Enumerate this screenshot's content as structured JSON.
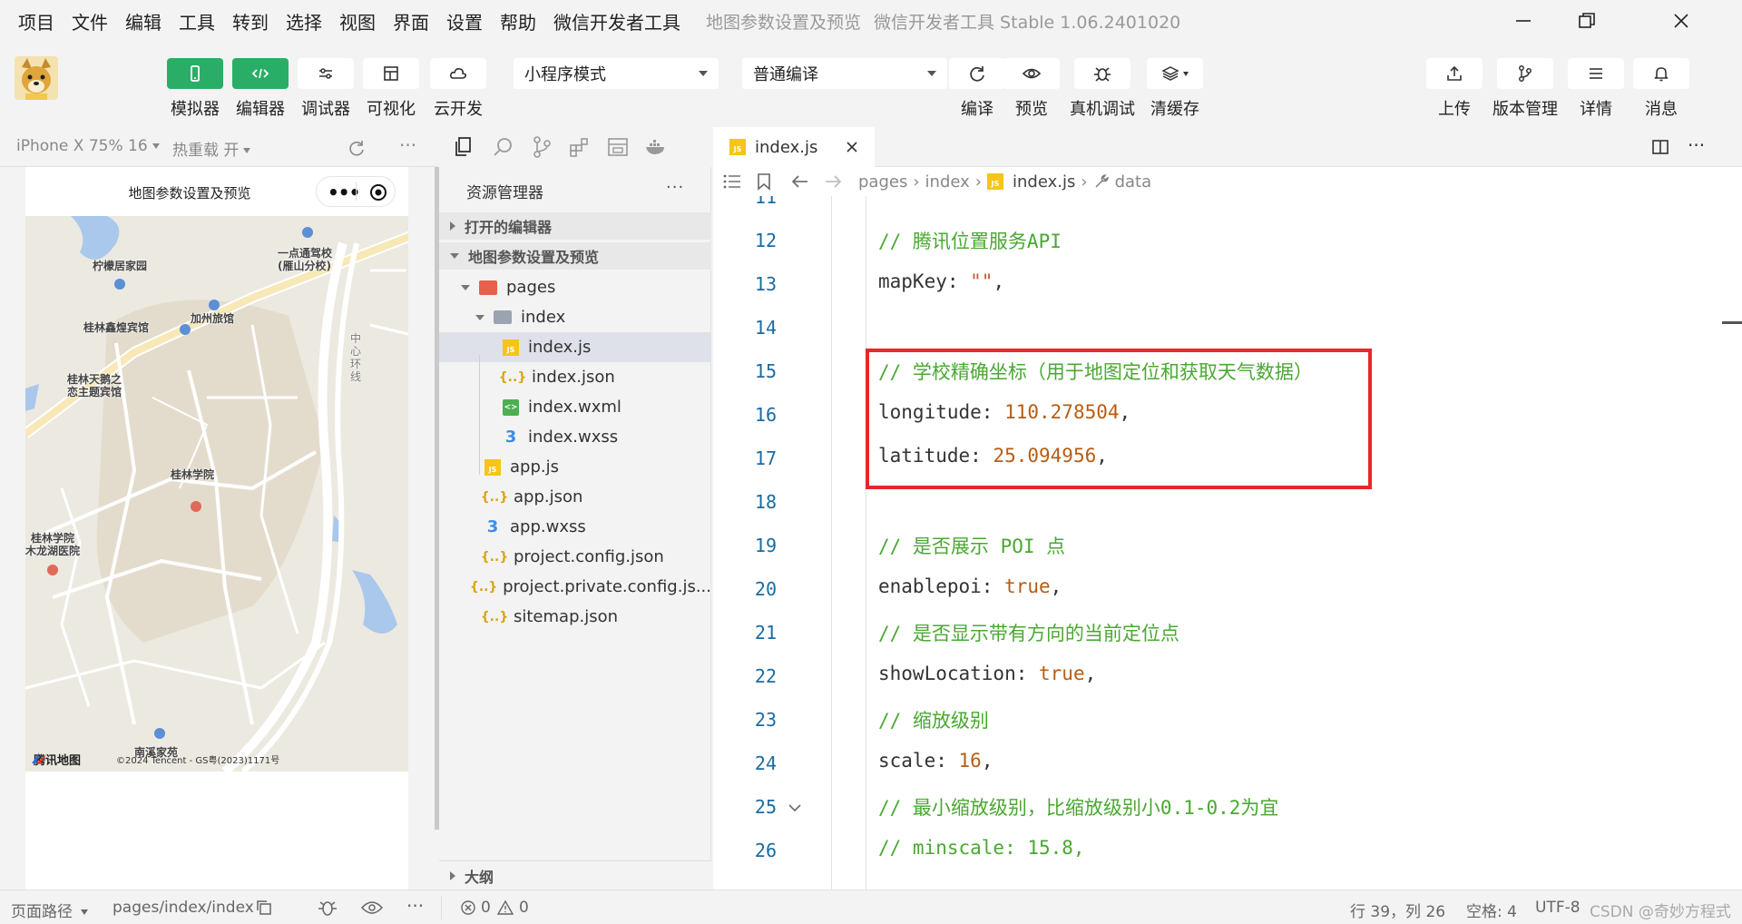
{
  "menu": [
    "项目",
    "文件",
    "编辑",
    "工具",
    "转到",
    "选择",
    "视图",
    "界面",
    "设置",
    "帮助",
    "微信开发者工具"
  ],
  "window": {
    "title": "地图参数设置及预览",
    "subtitle": "微信开发者工具 Stable 1.06.2401020"
  },
  "toolbar": {
    "left_buttons": [
      {
        "label": "模拟器",
        "icon": "phone-icon",
        "active": true
      },
      {
        "label": "编辑器",
        "icon": "code-icon",
        "active": true
      },
      {
        "label": "调试器",
        "icon": "sliders-icon",
        "active": false
      },
      {
        "label": "可视化",
        "icon": "layout-icon",
        "active": false
      },
      {
        "label": "云开发",
        "icon": "cloud-icon",
        "active": false
      }
    ],
    "mode_select": "小程序模式",
    "compile_select": "普通编译",
    "mid_buttons": [
      {
        "label": "编译",
        "icon": "refresh-icon"
      },
      {
        "label": "预览",
        "icon": "eye-icon"
      },
      {
        "label": "真机调试",
        "icon": "bug-icon"
      },
      {
        "label": "清缓存",
        "icon": "layers-icon"
      }
    ],
    "right_buttons": [
      {
        "label": "上传",
        "icon": "upload-icon"
      },
      {
        "label": "版本管理",
        "icon": "branch-icon"
      },
      {
        "label": "详情",
        "icon": "menu-icon"
      },
      {
        "label": "消息",
        "icon": "bell-icon"
      }
    ]
  },
  "simulator": {
    "device": "iPhone X 75% 16",
    "hot_reload": "热重载 开",
    "nav_title": "地图参数设置及预览",
    "map_labels": [
      "柠檬居家园",
      "一点通驾校",
      "(雁山分校)",
      "加州旅馆",
      "桂林鑫煌宾馆",
      "桂林天鹅之",
      "恋主题宾馆",
      "桂林学院",
      "桂林学院",
      "木龙湖医院",
      "南溪家苑",
      "中",
      "心",
      "环",
      "线"
    ],
    "map_logo": "腾讯地图",
    "map_copyright": "©2024 Tencent - GS粤(2023)1171号"
  },
  "explorer": {
    "title": "资源管理器",
    "more": "···",
    "open_editors": "打开的编辑器",
    "project": "地图参数设置及预览",
    "tree": [
      {
        "name": "pages",
        "type": "folder-red",
        "depth": 1,
        "expanded": true
      },
      {
        "name": "index",
        "type": "folder-gray",
        "depth": 2,
        "expanded": true
      },
      {
        "name": "index.js",
        "type": "js",
        "depth": 3,
        "selected": true
      },
      {
        "name": "index.json",
        "type": "json",
        "depth": 3
      },
      {
        "name": "index.wxml",
        "type": "wxml",
        "depth": 3
      },
      {
        "name": "index.wxss",
        "type": "wxss",
        "depth": 3
      },
      {
        "name": "app.js",
        "type": "js",
        "depth": 2
      },
      {
        "name": "app.json",
        "type": "json",
        "depth": 2
      },
      {
        "name": "app.wxss",
        "type": "wxss",
        "depth": 2
      },
      {
        "name": "project.config.json",
        "type": "json",
        "depth": 2
      },
      {
        "name": "project.private.config.js...",
        "type": "json",
        "depth": 2
      },
      {
        "name": "sitemap.json",
        "type": "json",
        "depth": 2
      }
    ],
    "outline": "大纲"
  },
  "editor": {
    "tab": "index.js",
    "breadcrumb": [
      "pages",
      "index",
      "index.js",
      "data"
    ],
    "lines": [
      {
        "n": "11",
        "tokens": []
      },
      {
        "n": "12",
        "tokens": [
          {
            "t": "comment",
            "v": "// 腾讯位置服务API"
          }
        ]
      },
      {
        "n": "13",
        "tokens": [
          {
            "t": "key",
            "v": "mapKey"
          },
          {
            "t": "punct",
            "v": ": "
          },
          {
            "t": "str",
            "v": "\"\""
          },
          {
            "t": "punct",
            "v": ","
          }
        ]
      },
      {
        "n": "14",
        "tokens": []
      },
      {
        "n": "15",
        "tokens": [
          {
            "t": "comment",
            "v": "// 学校精确坐标（用于地图定位和获取天气数据）"
          }
        ]
      },
      {
        "n": "16",
        "tokens": [
          {
            "t": "key",
            "v": "longitude"
          },
          {
            "t": "punct",
            "v": ": "
          },
          {
            "t": "num",
            "v": "110.278504"
          },
          {
            "t": "punct",
            "v": ","
          }
        ]
      },
      {
        "n": "17",
        "tokens": [
          {
            "t": "key",
            "v": "latitude"
          },
          {
            "t": "punct",
            "v": ": "
          },
          {
            "t": "num",
            "v": "25.094956"
          },
          {
            "t": "punct",
            "v": ","
          }
        ]
      },
      {
        "n": "18",
        "tokens": []
      },
      {
        "n": "19",
        "tokens": [
          {
            "t": "comment",
            "v": "// 是否展示 POI 点"
          }
        ]
      },
      {
        "n": "20",
        "tokens": [
          {
            "t": "key",
            "v": "enablepoi"
          },
          {
            "t": "punct",
            "v": ": "
          },
          {
            "t": "bool",
            "v": "true"
          },
          {
            "t": "punct",
            "v": ","
          }
        ]
      },
      {
        "n": "21",
        "tokens": [
          {
            "t": "comment",
            "v": "// 是否显示带有方向的当前定位点"
          }
        ]
      },
      {
        "n": "22",
        "tokens": [
          {
            "t": "key",
            "v": "showLocation"
          },
          {
            "t": "punct",
            "v": ": "
          },
          {
            "t": "bool",
            "v": "true"
          },
          {
            "t": "punct",
            "v": ","
          }
        ]
      },
      {
        "n": "23",
        "tokens": [
          {
            "t": "comment",
            "v": "// 缩放级别"
          }
        ]
      },
      {
        "n": "24",
        "tokens": [
          {
            "t": "key",
            "v": "scale"
          },
          {
            "t": "punct",
            "v": ": "
          },
          {
            "t": "num",
            "v": "16"
          },
          {
            "t": "punct",
            "v": ","
          }
        ]
      },
      {
        "n": "25",
        "tokens": [
          {
            "t": "comment",
            "v": "// 最小缩放级别，比缩放级别小0.1-0.2为宜"
          }
        ]
      },
      {
        "n": "26",
        "tokens": [
          {
            "t": "comment",
            "v": "// minscale: 15.8,"
          }
        ]
      }
    ]
  },
  "statusbar": {
    "page_path_label": "页面路径",
    "page_path": "pages/index/index",
    "errors": "0",
    "warnings": "0",
    "position": "行 39，列 26",
    "spaces": "空格: 4",
    "encoding": "UTF-8",
    "watermark": "CSDN @奇妙方程式"
  },
  "colors": {
    "accent_green": "#2aae67",
    "highlight_red": "#e8272b",
    "comment": "#4aa832",
    "number": "#b85c12"
  }
}
